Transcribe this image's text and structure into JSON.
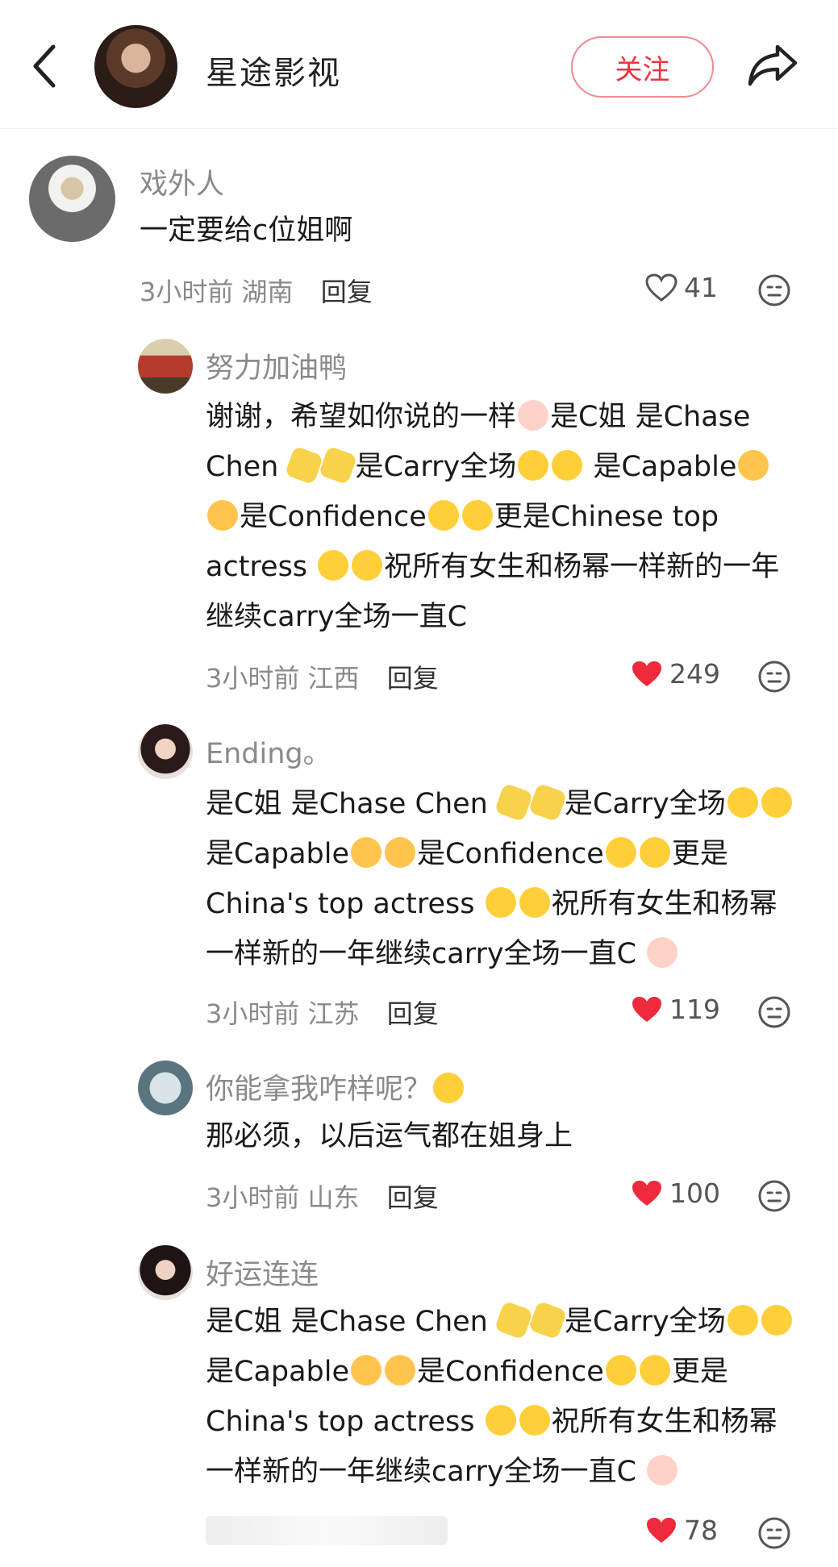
{
  "header": {
    "account_name": "星途影视",
    "follow_label": "关注"
  },
  "comments": [
    {
      "user": "戏外人",
      "text": "一定要给c位姐啊",
      "time": "3小时前",
      "location": "湖南",
      "reply": "回复",
      "likes": "41",
      "liked": false
    },
    {
      "user": "努力加油鸭",
      "text": "谢谢，希望如你说的一样🥺是C姐 是Chase Chen 💅💅是Carry全场😜😜 是Capable🥰🥰是Confidence😋😋更是Chinese top actress 🥳🥳祝所有女生和杨幂一样新的一年继续carry全场一直C",
      "time": "3小时前",
      "location": "江西",
      "reply": "回复",
      "likes": "249",
      "liked": true
    },
    {
      "user": "Ending。",
      "text": "是C姐 是Chase Chen 💅💅是Carry全场😜😜 是Capable🥰🥰是Confidence😋😋更是China's top actress 🥳🥳祝所有女生和杨幂一样新的一年继续carry全场一直C 🥺",
      "time": "3小时前",
      "location": "江苏",
      "reply": "回复",
      "likes": "119",
      "liked": true
    },
    {
      "user": "你能拿我咋样呢？😝",
      "text": "那必须，以后运气都在姐身上",
      "time": "3小时前",
      "location": "山东",
      "reply": "回复",
      "likes": "100",
      "liked": true
    },
    {
      "user": "好运连连",
      "text": "是C姐 是Chase Chen 💅💅是Carry全场😜😜 是Capable🥰🥰是Confidence😋😋更是China's top actress 🥳🥳祝所有女生和杨幂一样新的一年继续carry全场一直C 🥺",
      "likes": "78",
      "liked": true
    }
  ],
  "colors": {
    "accent_red": "#e8353f",
    "heart_red": "#ee2a3c",
    "muted_text": "#8a8a8a"
  }
}
